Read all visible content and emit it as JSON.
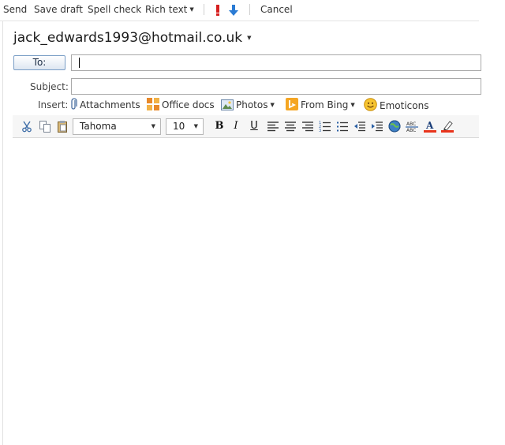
{
  "commands": {
    "send": "Send",
    "save_draft": "Save draft",
    "spell_check": "Spell check",
    "rich_text": "Rich text",
    "cancel": "Cancel"
  },
  "compose": {
    "from_address": "jack_edwards1993@hotmail.co.uk",
    "to_button": "To:",
    "to_value": "",
    "subject_label": "Subject:",
    "subject_value": ""
  },
  "insert": {
    "label": "Insert:",
    "attachments": "Attachments",
    "office_docs": "Office docs",
    "photos": "Photos",
    "from_bing": "From Bing",
    "emoticons": "Emoticons"
  },
  "format": {
    "font_family": "Tahoma",
    "font_size": "10",
    "bold": "B",
    "italic": "I",
    "underline": "U"
  },
  "icons": [
    "cut-icon",
    "copy-icon",
    "paste-icon",
    "align-left-icon",
    "align-center-icon",
    "align-right-icon",
    "numbered-list-icon",
    "bulleted-list-icon",
    "outdent-icon",
    "indent-icon",
    "hyperlink-icon",
    "strikethrough-icon",
    "font-color-icon",
    "highlight-icon",
    "high-importance-icon",
    "low-importance-icon"
  ],
  "colors": {
    "font_color_bar": "#e8341c",
    "highlight_bar": "#e8341c",
    "high_importance": "#d61f1f",
    "low_importance": "#2a7bd4"
  }
}
